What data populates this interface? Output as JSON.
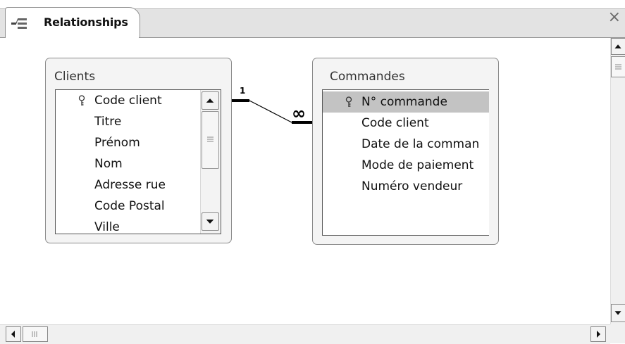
{
  "tab": {
    "title": "Relationships",
    "close": "×",
    "icon": "relationships-icon"
  },
  "tables": [
    {
      "name": "Clients",
      "fields": [
        "Code client",
        "Titre",
        "Prénom",
        "Nom",
        "Adresse rue",
        "Code Postal",
        "Ville"
      ],
      "primary_key": "Code client"
    },
    {
      "name": "Commandes",
      "fields": [
        "N° commande",
        "Code client",
        "Date de la comman",
        "Mode de paiement",
        "Numéro vendeur"
      ],
      "primary_key": "N° commande",
      "selected": "N° commande"
    }
  ],
  "relationship": {
    "one_label": "1",
    "many_label": "∞"
  },
  "icons": [
    "relationships-icon",
    "close-icon",
    "key-icon",
    "scroll-up-arrow-icon",
    "scroll-down-arrow-icon",
    "scroll-left-arrow-icon",
    "scroll-right-arrow-icon"
  ]
}
